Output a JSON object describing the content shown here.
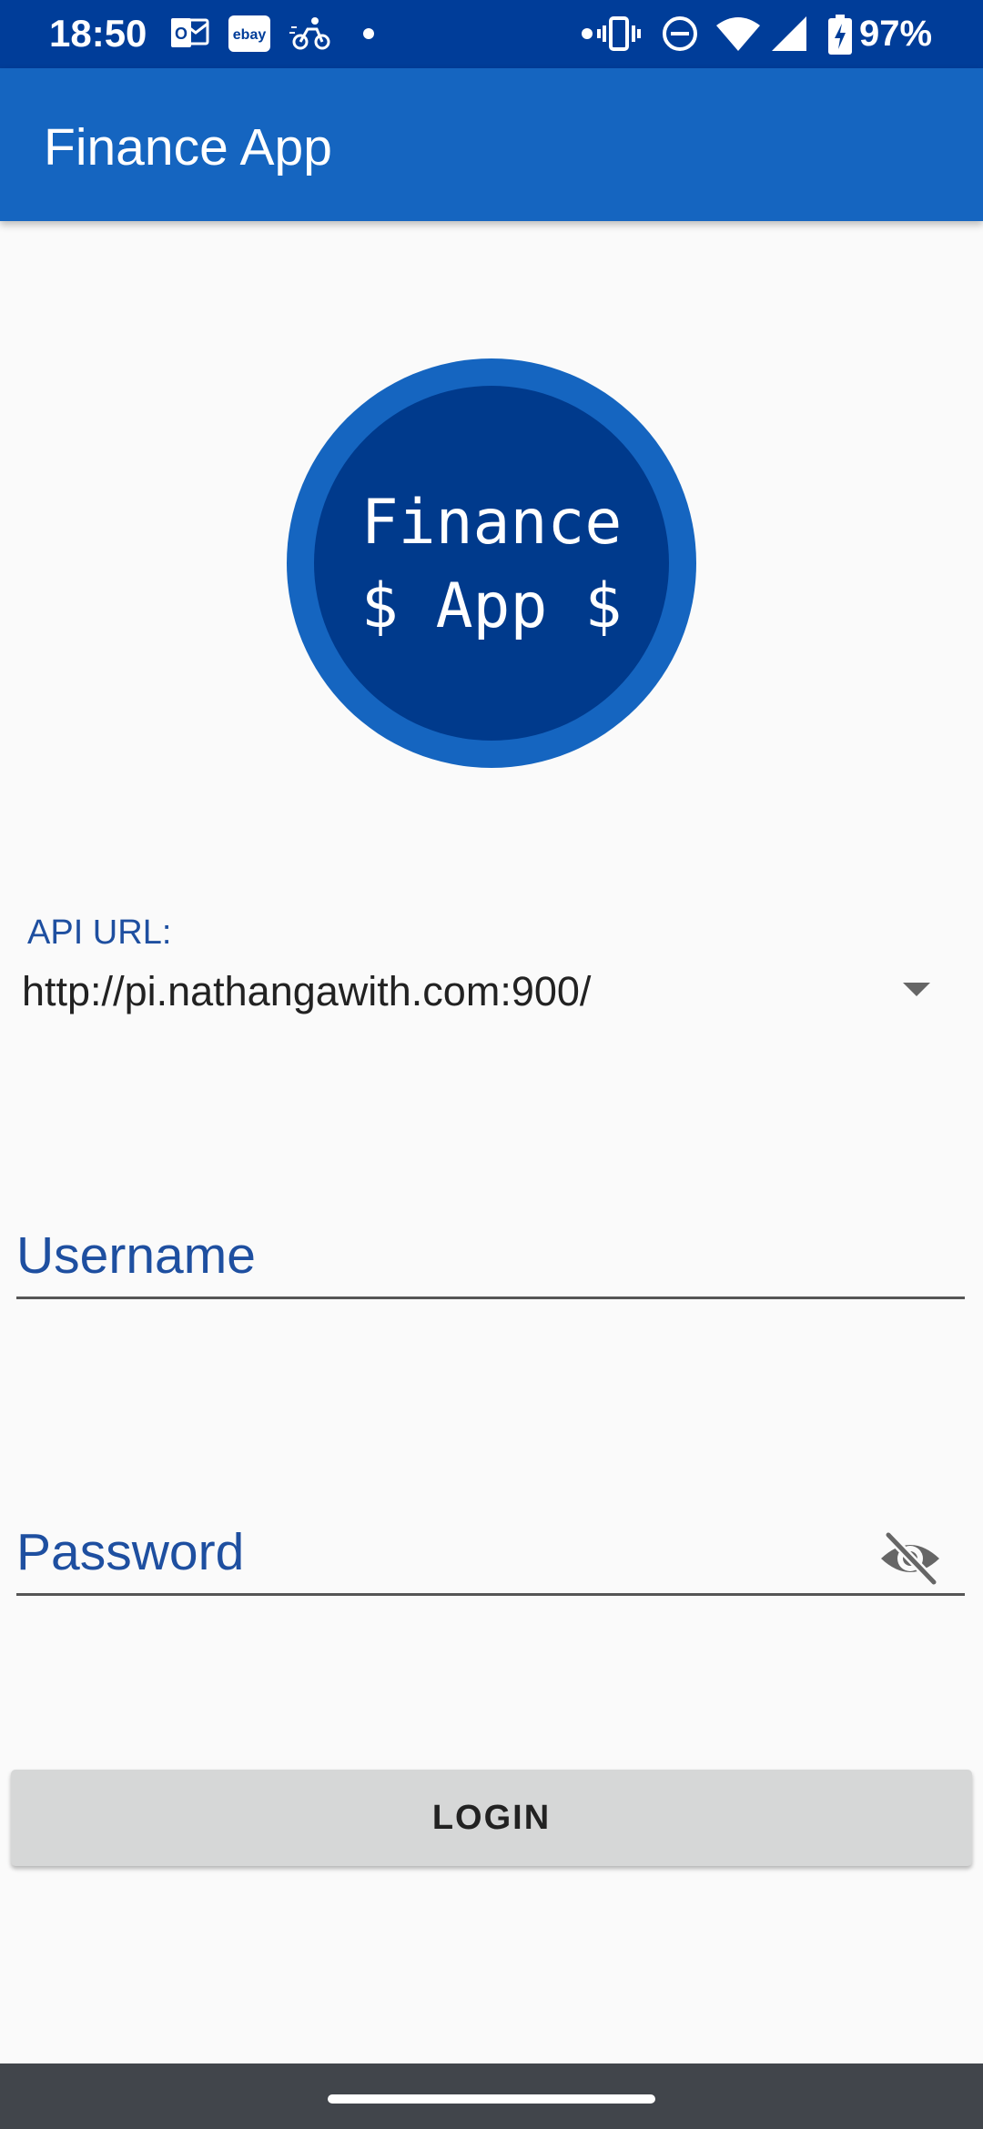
{
  "status_bar": {
    "time": "18:50",
    "battery_percent": "97%",
    "notification_icons": [
      "outlook-icon",
      "ebay-icon",
      "delivery-icon",
      "dot-icon"
    ],
    "system_icons": [
      "dot-icon",
      "vibrate-icon",
      "do-not-disturb-icon",
      "wifi-icon",
      "signal-icon",
      "battery-charging-icon"
    ]
  },
  "app_bar": {
    "title": "Finance App",
    "color": "#1565c0"
  },
  "logo": {
    "line1": "Finance",
    "line2": "$ App $",
    "outer_color": "#1565c0",
    "inner_color": "#003a8c"
  },
  "form": {
    "api_url_label": "API URL:",
    "api_url_value": "http://pi.nathangawith.com:900/",
    "username_placeholder": "Username",
    "username_value": "",
    "password_placeholder": "Password",
    "password_value": "",
    "password_toggle_icon": "eye-off-icon",
    "login_label": "LOGIN"
  },
  "colors": {
    "accent": "#1565c0",
    "label": "#1e4fa0",
    "status_bar": "#003d99",
    "nav_bar": "#41454b",
    "button": "#d6d7d7"
  }
}
